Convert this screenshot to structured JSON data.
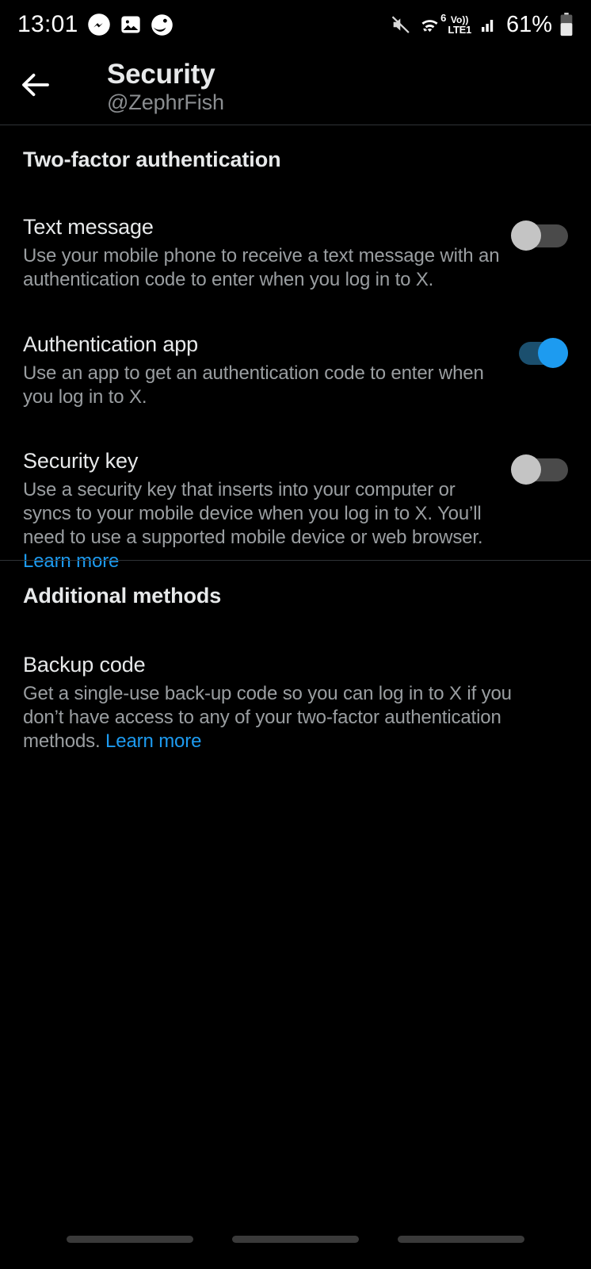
{
  "status_bar": {
    "time": "13:01",
    "notification_icons": [
      "messenger-icon",
      "gallery-icon",
      "app-circle-icon"
    ],
    "mute_icon": "volume-mute-icon",
    "wifi_icon": "wifi-icon",
    "wifi_generation": "6",
    "volte_top": "Vo))",
    "volte_bottom": "LTE1",
    "signal_icon": "cellular-signal-icon",
    "battery_percent": "61%",
    "battery_icon": "battery-icon"
  },
  "header": {
    "back_icon": "back-arrow-icon",
    "title": "Security",
    "subtitle": "@ZephrFish"
  },
  "sections": {
    "two_factor": {
      "title": "Two-factor authentication",
      "rows": [
        {
          "title": "Text message",
          "desc": "Use your mobile phone to receive a text message with an authentication code to enter when you log in to X.",
          "toggle_state": "off"
        },
        {
          "title": "Authentication app",
          "desc": "Use an app to get an authentication code to enter when you log in to X.",
          "toggle_state": "on"
        },
        {
          "title": "Security key",
          "desc": "Use a security key that inserts into your computer or syncs to your mobile device when you log in to X. You’ll need to use a supported mobile device or web browser. ",
          "link_label": "Learn more",
          "toggle_state": "off"
        }
      ]
    },
    "additional_methods": {
      "title": "Additional methods",
      "rows": [
        {
          "title": "Backup code",
          "desc": "Get a single-use back-up code so you can log in to X if you don’t have access to any of your two-factor authentication methods. ",
          "link_label": "Learn more"
        }
      ]
    }
  },
  "nav_bar": {
    "pills": [
      "nav-pill-left",
      "nav-pill-center",
      "nav-pill-right"
    ]
  },
  "colors": {
    "background": "#000000",
    "accent_blue": "#1d9bf0",
    "primary_text": "#e7e9ea",
    "secondary_text": "#9a9ea1",
    "divider": "#2f3336"
  }
}
